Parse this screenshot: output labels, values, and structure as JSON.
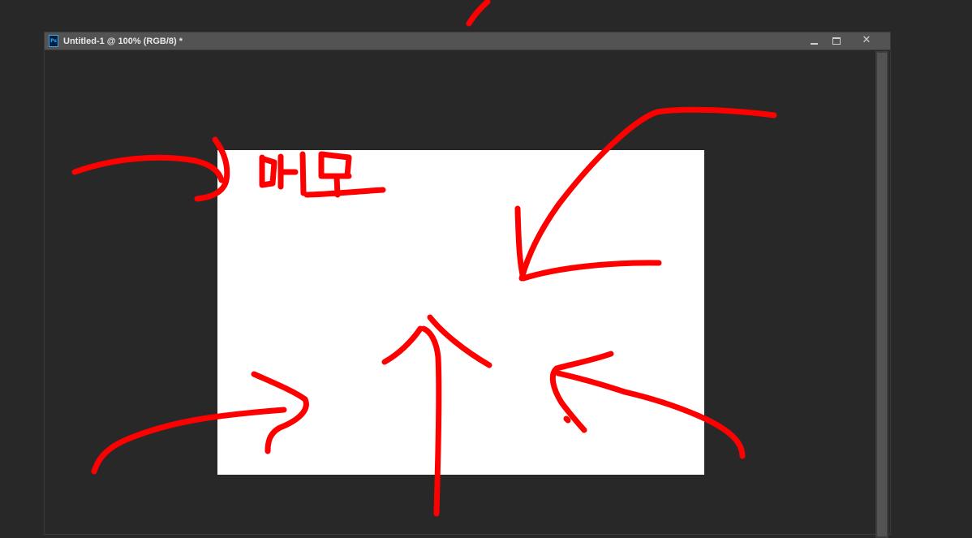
{
  "window": {
    "app_icon_label": "Ps",
    "title": "Untitled-1 @ 100% (RGB/8) *",
    "controls": {
      "minimize_icon": "minimize-icon",
      "maximize_icon": "maximize-icon",
      "close_glyph": "✕"
    }
  },
  "canvas": {
    "background": "#ffffff"
  },
  "annotation": {
    "color": "#ff0000",
    "handwritten_text": "메모"
  }
}
